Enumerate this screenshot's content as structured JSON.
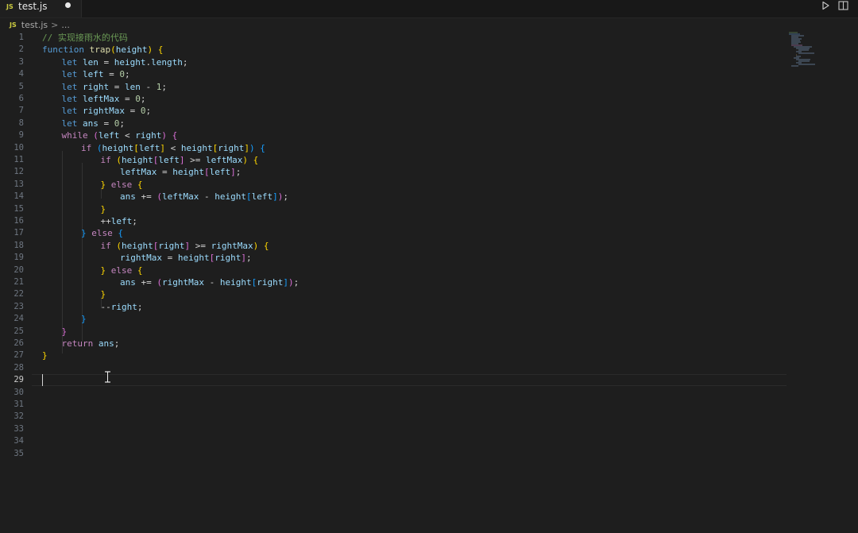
{
  "tab": {
    "language_badge": "JS",
    "file_name": "test.js"
  },
  "breadcrumb": {
    "language_badge": "JS",
    "file": "test.js",
    "separator": ">",
    "more": "..."
  },
  "toolbar": {
    "run_icon": "play-icon",
    "split_icon": "split-editor-icon"
  },
  "editor": {
    "cursor_line": 29,
    "line_numbers": [
      "1",
      "2",
      "3",
      "4",
      "5",
      "6",
      "7",
      "8",
      "9",
      "10",
      "11",
      "12",
      "13",
      "14",
      "15",
      "16",
      "17",
      "18",
      "19",
      "20",
      "21",
      "22",
      "23",
      "24",
      "25",
      "26",
      "27",
      "28",
      "29",
      "30",
      "31",
      "32",
      "33",
      "34",
      "35"
    ],
    "lines": [
      [
        [
          "// 实现接雨水的代码",
          "cm"
        ]
      ],
      [
        [
          "function",
          "kw"
        ],
        [
          " ",
          "op"
        ],
        [
          "trap",
          "fn"
        ],
        [
          "(",
          "b1"
        ],
        [
          "height",
          "vr"
        ],
        [
          ")",
          "b1"
        ],
        [
          " ",
          "op"
        ],
        [
          "{",
          "b1"
        ]
      ],
      [
        [
          "let",
          "kw"
        ],
        [
          " ",
          "op"
        ],
        [
          "len",
          "vr"
        ],
        [
          " = ",
          "op"
        ],
        [
          "height",
          "vr"
        ],
        [
          ".",
          "op"
        ],
        [
          "length",
          "vr"
        ],
        [
          ";",
          "op"
        ]
      ],
      [
        [
          "let",
          "kw"
        ],
        [
          " ",
          "op"
        ],
        [
          "left",
          "vr"
        ],
        [
          " = ",
          "op"
        ],
        [
          "0",
          "num"
        ],
        [
          ";",
          "op"
        ]
      ],
      [
        [
          "let",
          "kw"
        ],
        [
          " ",
          "op"
        ],
        [
          "right",
          "vr"
        ],
        [
          " = ",
          "op"
        ],
        [
          "len",
          "vr"
        ],
        [
          " - ",
          "op"
        ],
        [
          "1",
          "num"
        ],
        [
          ";",
          "op"
        ]
      ],
      [
        [
          "let",
          "kw"
        ],
        [
          " ",
          "op"
        ],
        [
          "leftMax",
          "vr"
        ],
        [
          " = ",
          "op"
        ],
        [
          "0",
          "num"
        ],
        [
          ";",
          "op"
        ]
      ],
      [
        [
          "let",
          "kw"
        ],
        [
          " ",
          "op"
        ],
        [
          "rightMax",
          "vr"
        ],
        [
          " = ",
          "op"
        ],
        [
          "0",
          "num"
        ],
        [
          ";",
          "op"
        ]
      ],
      [
        [
          "let",
          "kw"
        ],
        [
          " ",
          "op"
        ],
        [
          "ans",
          "vr"
        ],
        [
          " = ",
          "op"
        ],
        [
          "0",
          "num"
        ],
        [
          ";",
          "op"
        ]
      ],
      [
        [
          "while",
          "ctl"
        ],
        [
          " ",
          "op"
        ],
        [
          "(",
          "b2"
        ],
        [
          "left",
          "vr"
        ],
        [
          " < ",
          "op"
        ],
        [
          "right",
          "vr"
        ],
        [
          ")",
          "b2"
        ],
        [
          " ",
          "op"
        ],
        [
          "{",
          "b2"
        ]
      ],
      [
        [
          "if",
          "ctl"
        ],
        [
          " ",
          "op"
        ],
        [
          "(",
          "b3"
        ],
        [
          "height",
          "vr"
        ],
        [
          "[",
          "b1"
        ],
        [
          "left",
          "vr"
        ],
        [
          "]",
          "b1"
        ],
        [
          " < ",
          "op"
        ],
        [
          "height",
          "vr"
        ],
        [
          "[",
          "b1"
        ],
        [
          "right",
          "vr"
        ],
        [
          "]",
          "b1"
        ],
        [
          ")",
          "b3"
        ],
        [
          " ",
          "op"
        ],
        [
          "{",
          "b3"
        ]
      ],
      [
        [
          "if",
          "ctl"
        ],
        [
          " ",
          "op"
        ],
        [
          "(",
          "b1"
        ],
        [
          "height",
          "vr"
        ],
        [
          "[",
          "b2"
        ],
        [
          "left",
          "vr"
        ],
        [
          "]",
          "b2"
        ],
        [
          " >= ",
          "op"
        ],
        [
          "leftMax",
          "vr"
        ],
        [
          ")",
          "b1"
        ],
        [
          " ",
          "op"
        ],
        [
          "{",
          "b1"
        ]
      ],
      [
        [
          "leftMax",
          "vr"
        ],
        [
          " = ",
          "op"
        ],
        [
          "height",
          "vr"
        ],
        [
          "[",
          "b2"
        ],
        [
          "left",
          "vr"
        ],
        [
          "]",
          "b2"
        ],
        [
          ";",
          "op"
        ]
      ],
      [
        [
          "}",
          "b1"
        ],
        [
          " ",
          "op"
        ],
        [
          "else",
          "ctl"
        ],
        [
          " ",
          "op"
        ],
        [
          "{",
          "b1"
        ]
      ],
      [
        [
          "ans",
          "vr"
        ],
        [
          " += ",
          "op"
        ],
        [
          "(",
          "b2"
        ],
        [
          "leftMax",
          "vr"
        ],
        [
          " - ",
          "op"
        ],
        [
          "height",
          "vr"
        ],
        [
          "[",
          "b3"
        ],
        [
          "left",
          "vr"
        ],
        [
          "]",
          "b3"
        ],
        [
          ")",
          "b2"
        ],
        [
          ";",
          "op"
        ]
      ],
      [
        [
          "}",
          "b1"
        ]
      ],
      [
        [
          "++",
          "op"
        ],
        [
          "left",
          "vr"
        ],
        [
          ";",
          "op"
        ]
      ],
      [
        [
          "}",
          "b3"
        ],
        [
          " ",
          "op"
        ],
        [
          "else",
          "ctl"
        ],
        [
          " ",
          "op"
        ],
        [
          "{",
          "b3"
        ]
      ],
      [
        [
          "if",
          "ctl"
        ],
        [
          " ",
          "op"
        ],
        [
          "(",
          "b1"
        ],
        [
          "height",
          "vr"
        ],
        [
          "[",
          "b2"
        ],
        [
          "right",
          "vr"
        ],
        [
          "]",
          "b2"
        ],
        [
          " >= ",
          "op"
        ],
        [
          "rightMax",
          "vr"
        ],
        [
          ")",
          "b1"
        ],
        [
          " ",
          "op"
        ],
        [
          "{",
          "b1"
        ]
      ],
      [
        [
          "rightMax",
          "vr"
        ],
        [
          " = ",
          "op"
        ],
        [
          "height",
          "vr"
        ],
        [
          "[",
          "b2"
        ],
        [
          "right",
          "vr"
        ],
        [
          "]",
          "b2"
        ],
        [
          ";",
          "op"
        ]
      ],
      [
        [
          "}",
          "b1"
        ],
        [
          " ",
          "op"
        ],
        [
          "else",
          "ctl"
        ],
        [
          " ",
          "op"
        ],
        [
          "{",
          "b1"
        ]
      ],
      [
        [
          "ans",
          "vr"
        ],
        [
          " += ",
          "op"
        ],
        [
          "(",
          "b2"
        ],
        [
          "rightMax",
          "vr"
        ],
        [
          " - ",
          "op"
        ],
        [
          "height",
          "vr"
        ],
        [
          "[",
          "b3"
        ],
        [
          "right",
          "vr"
        ],
        [
          "]",
          "b3"
        ],
        [
          ")",
          "b2"
        ],
        [
          ";",
          "op"
        ]
      ],
      [
        [
          "}",
          "b1"
        ]
      ],
      [
        [
          "--",
          "op"
        ],
        [
          "right",
          "vr"
        ],
        [
          ";",
          "op"
        ]
      ],
      [
        [
          "}",
          "b3"
        ]
      ],
      [
        [
          "}",
          "b2"
        ]
      ],
      [
        [
          "return",
          "ctl"
        ],
        [
          " ",
          "op"
        ],
        [
          "ans",
          "vr"
        ],
        [
          ";",
          "op"
        ]
      ],
      [
        [
          "}",
          "b1"
        ]
      ],
      [],
      [],
      [],
      [],
      [],
      [],
      [],
      []
    ]
  }
}
